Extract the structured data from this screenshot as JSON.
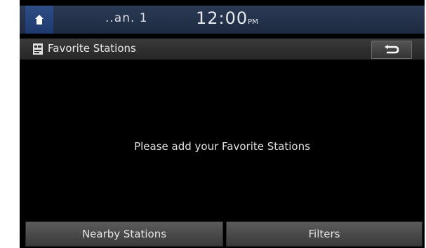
{
  "status_bar": {
    "home_icon": "home-icon",
    "label": "..an. 1",
    "time": "12:00",
    "ampm": "PM"
  },
  "title_bar": {
    "icon": "favorite-list-icon",
    "title": "Favorite Stations",
    "back_icon": "back-arrow-icon"
  },
  "main": {
    "message": "Please add your Favorite Stations"
  },
  "bottom_buttons": {
    "nearby_label": "Nearby Stations",
    "filters_label": "Filters"
  },
  "colors": {
    "status_bar": "#243350",
    "home_button": "#2b4a80",
    "title_bar": "#2f2f2f",
    "screen_bg": "#000000",
    "button_bg": "#4a4a4a"
  }
}
